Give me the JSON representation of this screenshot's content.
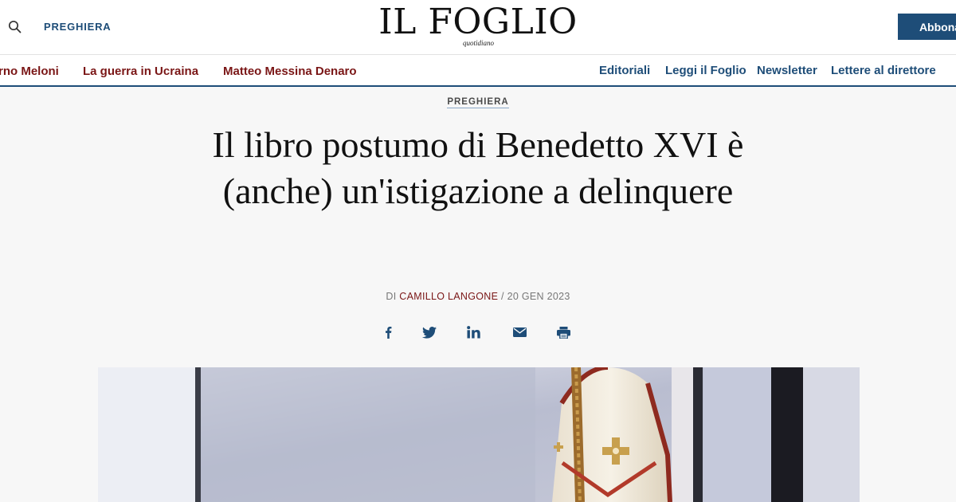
{
  "header": {
    "section_label": "PREGHIERA",
    "logo": "IL FOGLIO",
    "logo_subtitle": "quotidiano",
    "subscribe_label": "Abbona",
    "search_icon": "search-icon"
  },
  "nav": {
    "topics": [
      "rno Meloni",
      "La guerra in Ucraina",
      "Matteo Messina Denaro"
    ],
    "links": [
      "Editoriali",
      "Leggi il Foglio",
      "Newsletter",
      "Lettere al direttore"
    ]
  },
  "article": {
    "kicker": "PREGHIERA",
    "title": "Il libro postumo di Benedetto XVI è (anche) un'istigazione a delinquere",
    "byline_prefix": "DI",
    "author": "CAMILLO LANGONE",
    "date": "/ 20 GEN 2023"
  },
  "share": [
    "facebook-icon",
    "twitter-icon",
    "linkedin-icon",
    "email-icon",
    "print-icon"
  ],
  "colors": {
    "brand_blue": "#1e4d78",
    "topic_red": "#7a1616"
  }
}
